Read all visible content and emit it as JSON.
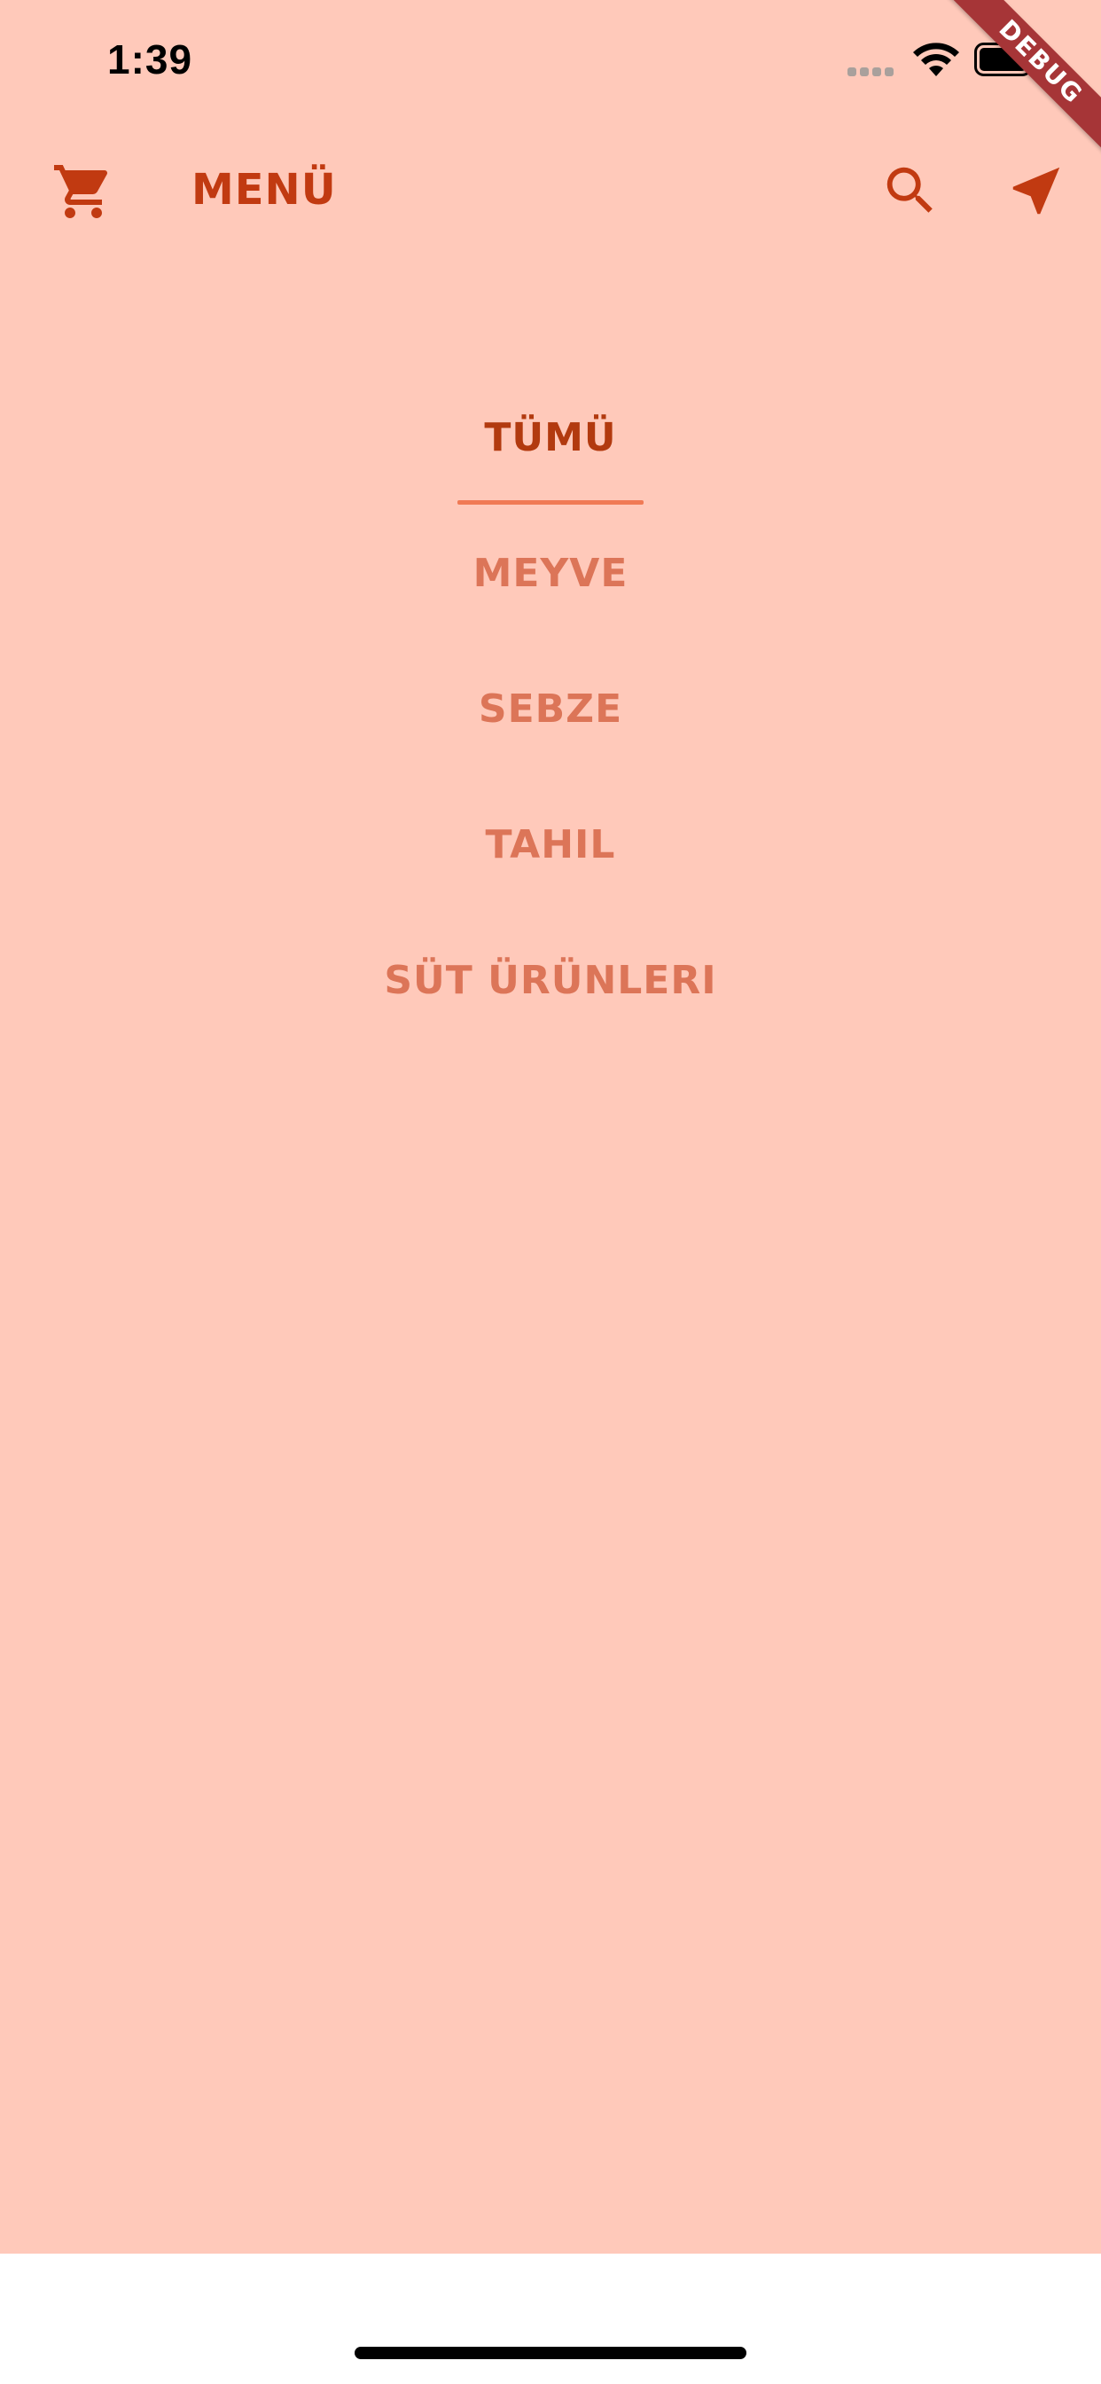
{
  "status_bar": {
    "time": "1:39"
  },
  "debug_banner": {
    "label": "DEBUG"
  },
  "app_bar": {
    "title": "MENÜ",
    "icons": [
      "cart-icon",
      "search-icon",
      "navigation-arrow-icon"
    ]
  },
  "categories": {
    "items": [
      {
        "label": "TÜMÜ",
        "active": true
      },
      {
        "label": "MEYVE",
        "active": false
      },
      {
        "label": "SEBZE",
        "active": false
      },
      {
        "label": "TAHIL",
        "active": false
      },
      {
        "label": "SÜT ÜRÜNLERI",
        "active": false
      }
    ]
  },
  "colors": {
    "background": "#FFC9BA",
    "accent": "#C13A11",
    "inactive_text": "#DC7558",
    "underline": "#F07A55",
    "debug_ribbon": "#A63537"
  }
}
